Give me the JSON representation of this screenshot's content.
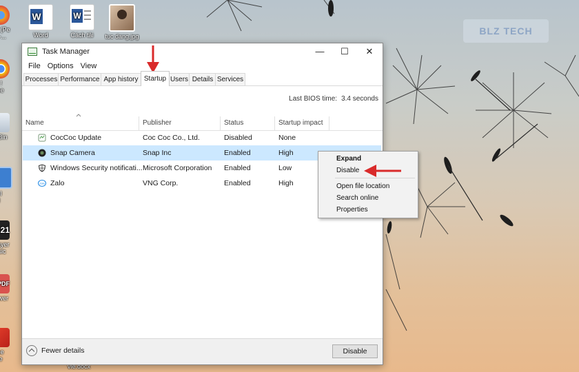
{
  "desktop": {
    "icons": [
      {
        "label": "Word",
        "name": "word-desktop-icon"
      },
      {
        "label": "Cách tải",
        "name": "cach-tai-desktop-icon"
      },
      {
        "label": "tuc dang.jpg",
        "name": "tuc-dang-desktop-icon"
      }
    ],
    "edge_labels": {
      "browser1": [
        "ng (Pe",
        "g) -..."
      ],
      "browser2": [
        "ận !",
        "ome"
      ],
      "recycle": [
        "le Bin"
      ],
      "control": [
        "itrol",
        "nel"
      ],
      "player": [
        "Player",
        "assic"
      ],
      "pdf": [
        "/iewer"
      ],
      "tone": [
        "tone",
        "ture"
      ]
    },
    "bottom_label": "vie.docx",
    "watermark": "BLZ TECH",
    "colors": {
      "word_blue": "#2b579a",
      "chrome_orange": "#f4a31b"
    }
  },
  "window": {
    "title": "Task Manager",
    "controls": {
      "minimize": "—",
      "maximize": "☐",
      "close": "✕"
    },
    "menu": [
      "File",
      "Options",
      "View"
    ],
    "tabs": [
      "Processes",
      "Performance",
      "App history",
      "Startup",
      "Users",
      "Details",
      "Services"
    ],
    "active_tab": "Startup",
    "bios": {
      "label": "Last BIOS time:",
      "value": "3.4 seconds"
    },
    "columns": [
      "Name",
      "Publisher",
      "Status",
      "Startup impact"
    ],
    "rows": [
      {
        "name": "CocCoc Update",
        "publisher": "Coc Coc Co., Ltd.",
        "status": "Disabled",
        "impact": "None",
        "icon": "coccoc-update-icon"
      },
      {
        "name": "Snap Camera",
        "publisher": "Snap Inc",
        "status": "Enabled",
        "impact": "High",
        "icon": "snap-camera-icon"
      },
      {
        "name": "Windows Security notificati...",
        "publisher": "Microsoft Corporation",
        "status": "Enabled",
        "impact": "Low",
        "icon": "shield-icon"
      },
      {
        "name": "Zalo",
        "publisher": "VNG Corp.",
        "status": "Enabled",
        "impact": "High",
        "icon": "zalo-icon"
      }
    ],
    "selected_row": "Snap Camera",
    "fewer_details": "Fewer details",
    "disable_button": "Disable"
  },
  "context_menu": {
    "items": [
      "Expand",
      "Disable",
      "Open file location",
      "Search online",
      "Properties"
    ]
  },
  "annotation_color": "#d92b2b"
}
